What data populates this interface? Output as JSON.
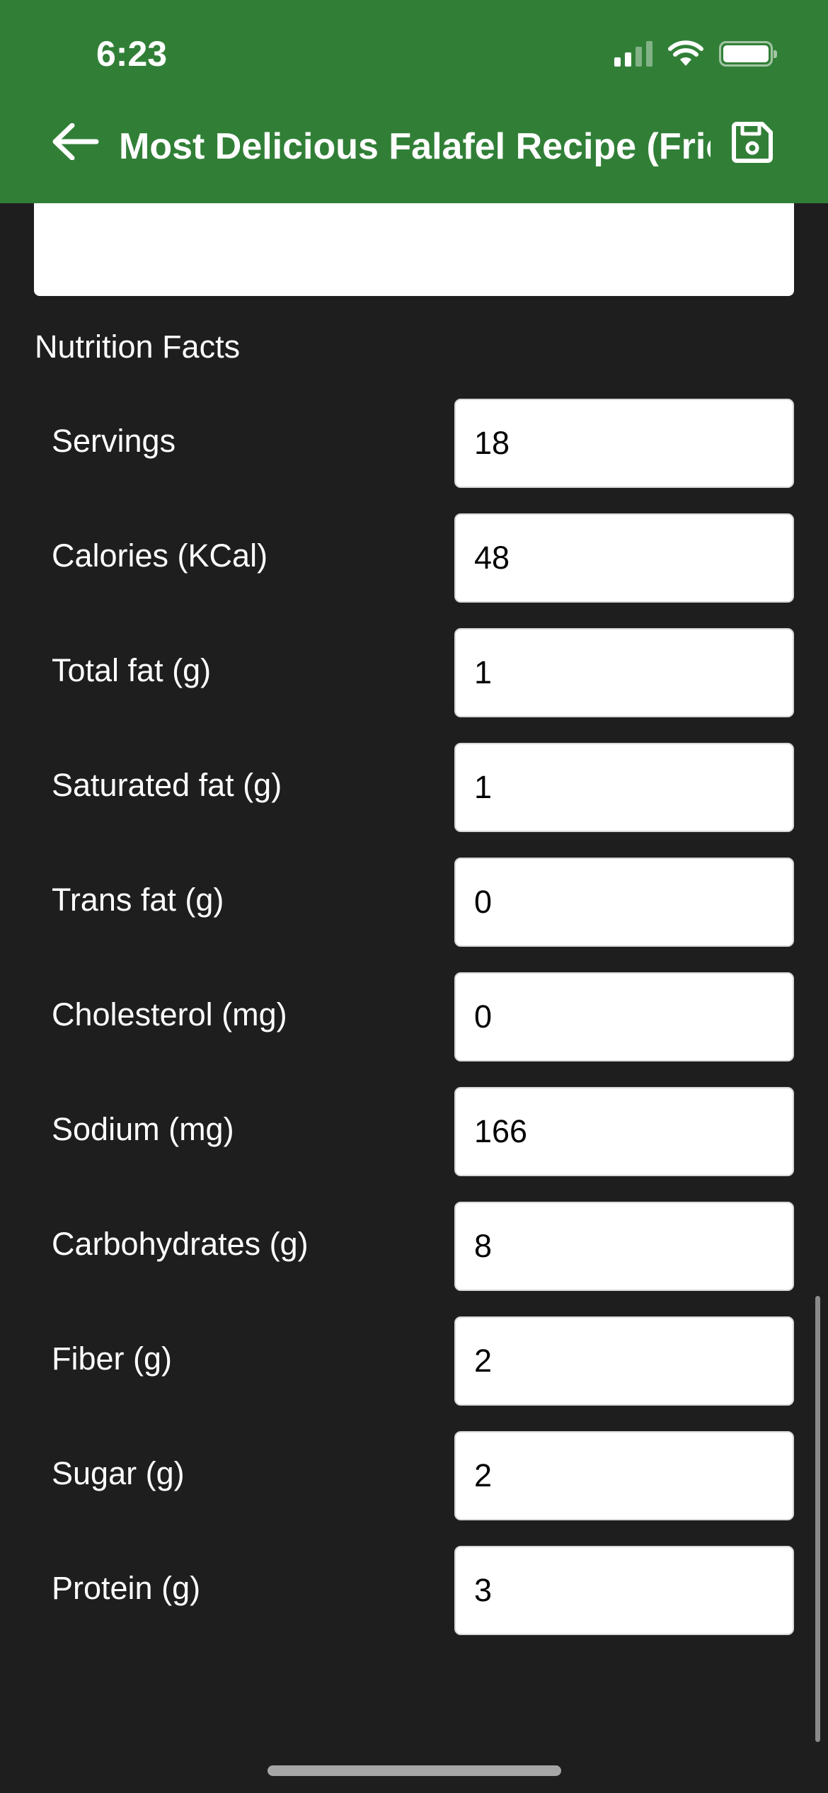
{
  "status_bar": {
    "time": "6:23"
  },
  "appbar": {
    "title": "Most Delicious Falafel Recipe (Fried or Baked)",
    "back_icon": "arrow-left-icon",
    "save_icon": "floppy-disk-icon",
    "color": "#317f37"
  },
  "nutrition": {
    "heading": "Nutrition Facts",
    "rows": [
      {
        "label": "Servings",
        "value": "18"
      },
      {
        "label": "Calories (KCal)",
        "value": "48"
      },
      {
        "label": "Total fat (g)",
        "value": "1"
      },
      {
        "label": "Saturated fat (g)",
        "value": "1"
      },
      {
        "label": "Trans fat (g)",
        "value": "0"
      },
      {
        "label": "Cholesterol (mg)",
        "value": "0"
      },
      {
        "label": "Sodium (mg)",
        "value": "166"
      },
      {
        "label": "Carbohydrates (g)",
        "value": "8"
      },
      {
        "label": "Fiber (g)",
        "value": "2"
      },
      {
        "label": "Sugar (g)",
        "value": "2"
      },
      {
        "label": "Protein (g)",
        "value": "3"
      }
    ]
  },
  "theme": {
    "background": "#1e1e1e",
    "field_background": "#ffffff"
  }
}
